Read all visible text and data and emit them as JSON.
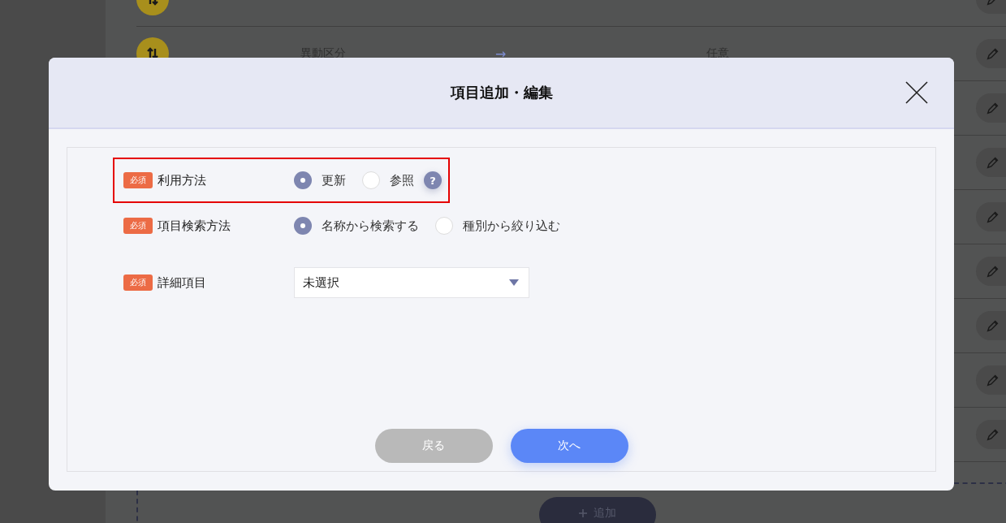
{
  "background": {
    "rows": [
      {
        "kind": "icon_only"
      },
      {
        "kind": "full",
        "name": "異動区分",
        "arrow": "→",
        "requirement": "任意"
      },
      {
        "kind": "covered"
      },
      {
        "kind": "covered"
      },
      {
        "kind": "covered"
      },
      {
        "kind": "covered"
      },
      {
        "kind": "covered"
      },
      {
        "kind": "covered"
      },
      {
        "kind": "covered"
      }
    ],
    "add_button": "追加"
  },
  "dialog": {
    "title": "項目追加・編集",
    "fields": [
      {
        "kind": "radio",
        "badge": "必須",
        "label": "利用方法",
        "highlighted": true,
        "help": "?",
        "options": [
          {
            "label": "更新",
            "selected": true
          },
          {
            "label": "参照",
            "selected": false
          }
        ]
      },
      {
        "kind": "radio",
        "badge": "必須",
        "label": "項目検索方法",
        "highlighted": false,
        "options": [
          {
            "label": "名称から検索する",
            "selected": true
          },
          {
            "label": "種別から絞り込む",
            "selected": false
          }
        ]
      },
      {
        "kind": "select",
        "badge": "必須",
        "label": "詳細項目",
        "value": "未選択"
      }
    ],
    "buttons": [
      {
        "label": "戻る",
        "kind": "secondary"
      },
      {
        "label": "次へ",
        "kind": "primary"
      }
    ]
  }
}
